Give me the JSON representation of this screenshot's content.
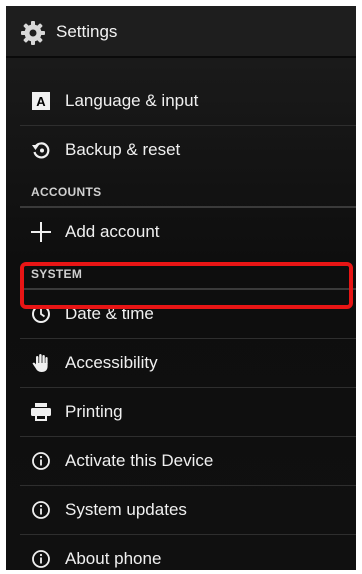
{
  "action_bar": {
    "title": "Settings",
    "icon": "gear-icon"
  },
  "items": [
    {
      "label": "Language & input",
      "icon": "language-icon"
    },
    {
      "label": "Backup & reset",
      "icon": "backup-restore-icon"
    },
    {
      "label": "Add account",
      "icon": "plus-icon"
    },
    {
      "label": "Date & time",
      "icon": "clock-icon",
      "highlighted": true
    },
    {
      "label": "Accessibility",
      "icon": "hand-icon"
    },
    {
      "label": "Printing",
      "icon": "printer-icon"
    },
    {
      "label": "Activate this Device",
      "icon": "info-icon"
    },
    {
      "label": "System updates",
      "icon": "info-icon"
    },
    {
      "label": "About phone",
      "icon": "info-icon"
    }
  ],
  "sections": {
    "accounts": "ACCOUNTS",
    "system": "SYSTEM"
  },
  "colors": {
    "highlight_border": "#e81515",
    "text": "#f0f0f0",
    "header_text": "#d0d0d0"
  }
}
